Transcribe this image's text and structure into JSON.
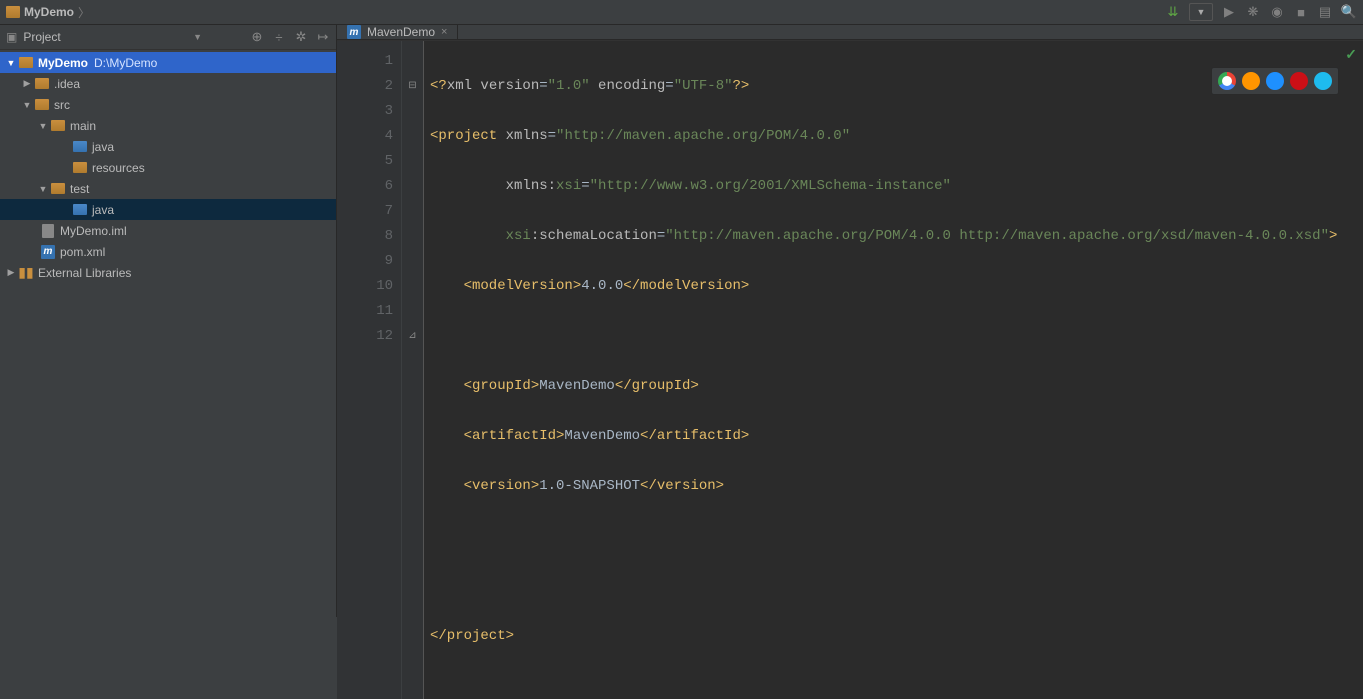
{
  "breadcrumb": {
    "project": "MyDemo"
  },
  "sidebar": {
    "title": "Project",
    "nodes": {
      "root": {
        "name": "MyDemo",
        "path": "D:\\MyDemo"
      },
      "idea": ".idea",
      "src": "src",
      "main": "main",
      "java1": "java",
      "resources": "resources",
      "test": "test",
      "java2": "java",
      "iml": "MyDemo.iml",
      "pom": "pom.xml",
      "ext": "External Libraries"
    }
  },
  "tab": {
    "label": "MavenDemo"
  },
  "code": {
    "l1": {
      "a": "<?",
      "b": "xml version",
      "c": "=",
      "d": "\"1.0\"",
      "e": " encoding",
      "f": "=",
      "g": "\"UTF-8\"",
      "h": "?>"
    },
    "l2": {
      "a": "<project",
      "b": " xmlns",
      "c": "=",
      "d": "\"http://maven.apache.org/POM/4.0.0\""
    },
    "l3": {
      "a": "         xmlns:",
      "b": "xsi",
      "c": "=",
      "d": "\"http://www.w3.org/2001/XMLSchema-instance\""
    },
    "l4": {
      "a": "         ",
      "b": "xsi",
      "c": ":schemaLocation",
      "d": "=",
      "e": "\"http://maven.apache.org/POM/4.0.0 http://maven.apache.org/xsd/maven-4.0.0.xsd\"",
      "f": ">"
    },
    "l5": {
      "a": "    <modelVersion>",
      "b": "4.0.0",
      "c": "</modelVersion>"
    },
    "l7": {
      "a": "    <groupId>",
      "b": "MavenDemo",
      "c": "</groupId>"
    },
    "l8": {
      "a": "    <artifactId>",
      "b": "MavenDemo",
      "c": "</artifactId>"
    },
    "l9": {
      "a": "    <version>",
      "b": "1.0-SNAPSHOT",
      "c": "</version>"
    },
    "l12": {
      "a": "</project>"
    }
  },
  "line_numbers": [
    "1",
    "2",
    "3",
    "4",
    "5",
    "6",
    "7",
    "8",
    "9",
    "10",
    "11",
    "12"
  ]
}
